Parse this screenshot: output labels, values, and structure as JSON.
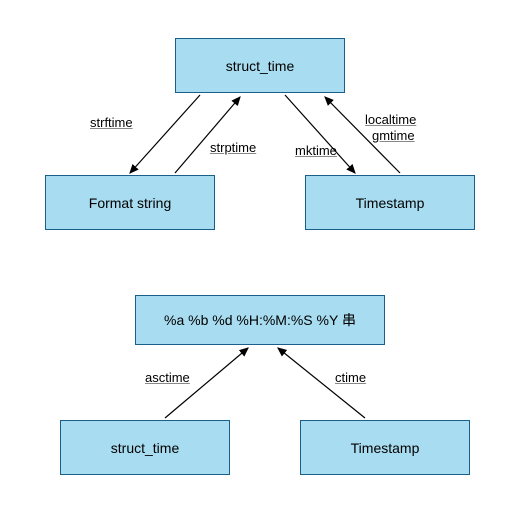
{
  "diagram1": {
    "nodes": {
      "struct_time": "struct_time",
      "format_string": "Format string",
      "timestamp": "Timestamp"
    },
    "edges": {
      "strftime": "strftime",
      "strptime": "strptime",
      "mktime": "mktime",
      "localtime": "localtime",
      "gmtime": "gmtime"
    }
  },
  "diagram2": {
    "nodes": {
      "format_pattern": "%a %b %d %H:%M:%S %Y 串",
      "struct_time": "struct_time",
      "timestamp": "Timestamp"
    },
    "edges": {
      "asctime": "asctime",
      "ctime": "ctime"
    }
  },
  "chart_data": {
    "type": "diagram",
    "description": "Two flow diagrams showing Python time module conversion functions",
    "diagrams": [
      {
        "nodes": [
          "struct_time",
          "Format string",
          "Timestamp"
        ],
        "edges": [
          {
            "from": "struct_time",
            "to": "Format string",
            "label": "strftime"
          },
          {
            "from": "Format string",
            "to": "struct_time",
            "label": "strptime"
          },
          {
            "from": "struct_time",
            "to": "Timestamp",
            "label": "mktime"
          },
          {
            "from": "Timestamp",
            "to": "struct_time",
            "label": "localtime"
          },
          {
            "from": "Timestamp",
            "to": "struct_time",
            "label": "gmtime"
          }
        ]
      },
      {
        "nodes": [
          "%a %b %d %H:%M:%S %Y 串",
          "struct_time",
          "Timestamp"
        ],
        "edges": [
          {
            "from": "struct_time",
            "to": "%a %b %d %H:%M:%S %Y 串",
            "label": "asctime"
          },
          {
            "from": "Timestamp",
            "to": "%a %b %d %H:%M:%S %Y 串",
            "label": "ctime"
          }
        ]
      }
    ]
  }
}
